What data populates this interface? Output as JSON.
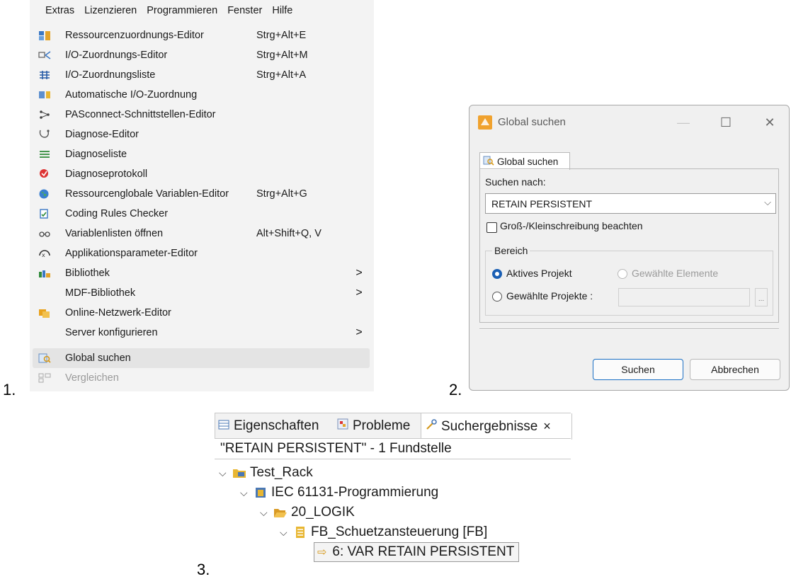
{
  "steps": [
    "1.",
    "2.",
    "3."
  ],
  "menubar": {
    "items": [
      "Extras",
      "Lizenzieren",
      "Programmieren",
      "Fenster",
      "Hilfe"
    ]
  },
  "menu": {
    "items": [
      {
        "label": "Ressourcenzuordnungs-Editor",
        "shortcut": "Strg+Alt+E",
        "icon": "resource-assign-icon"
      },
      {
        "label": "I/O-Zuordnungs-Editor",
        "shortcut": "Strg+Alt+M",
        "icon": "io-assign-icon"
      },
      {
        "label": "I/O-Zuordnungsliste",
        "shortcut": "Strg+Alt+A",
        "icon": "io-list-icon"
      },
      {
        "label": "Automatische I/O-Zuordnung",
        "shortcut": "",
        "icon": "auto-io-icon"
      },
      {
        "label": "PASconnect-Schnittstellen-Editor",
        "shortcut": "",
        "icon": "pasconnect-icon"
      },
      {
        "label": "Diagnose-Editor",
        "shortcut": "",
        "icon": "diagnosis-icon"
      },
      {
        "label": "Diagnoseliste",
        "shortcut": "",
        "icon": "diagnosis-list-icon"
      },
      {
        "label": "Diagnoseprotokoll",
        "shortcut": "",
        "icon": "diagnosis-log-icon"
      },
      {
        "label": "Ressourcenglobale Variablen-Editor",
        "shortcut": "Strg+Alt+G",
        "icon": "globe-icon"
      },
      {
        "label": "Coding Rules Checker",
        "shortcut": "",
        "icon": "rules-checker-icon"
      },
      {
        "label": "Variablenlisten öffnen",
        "shortcut": "Alt+Shift+Q, V",
        "icon": "glasses-icon"
      },
      {
        "label": "Applikationsparameter-Editor",
        "shortcut": "",
        "icon": "parameter-icon"
      },
      {
        "label": "Bibliothek",
        "shortcut": "",
        "icon": "library-icon",
        "submenu": true
      },
      {
        "label": "MDF-Bibliothek",
        "shortcut": "",
        "icon": "",
        "submenu": true
      },
      {
        "label": "Online-Netzwerk-Editor",
        "shortcut": "",
        "icon": "network-icon"
      },
      {
        "label": "Server konfigurieren",
        "shortcut": "",
        "icon": "",
        "submenu": true
      },
      {
        "label": "Global suchen",
        "shortcut": "",
        "icon": "global-search-icon",
        "selected": true
      },
      {
        "label": "Vergleichen",
        "shortcut": "",
        "icon": "compare-icon",
        "disabled": true
      }
    ],
    "submenu_arrow": ">"
  },
  "dialog": {
    "title": "Global suchen",
    "minimize": "—",
    "maximize": "☐",
    "close": "✕",
    "tab_label": "Global suchen",
    "search_for_label": "Suchen nach:",
    "search_value": "RETAIN PERSISTENT",
    "dropdown_arrow": "⌵",
    "case_label": "Groß-/Kleinschreibung beachten",
    "case_checked": false,
    "scope_label": "Bereich",
    "active_project": "Aktives Projekt",
    "selected_elements": "Gewählte Elemente",
    "selected_projects": "Gewählte Projekte :",
    "browse": "...",
    "ok_button": "Suchen",
    "cancel_button": "Abbrechen"
  },
  "results": {
    "tabs": [
      {
        "label": "Eigenschaften",
        "icon": "properties-icon"
      },
      {
        "label": "Probleme",
        "icon": "problems-icon"
      },
      {
        "label": "Suchergebnisse",
        "icon": "search-results-icon",
        "active": true
      }
    ],
    "close": "×",
    "summary": "\"RETAIN PERSISTENT\" - 1 Fundstelle",
    "tree": [
      {
        "label": "Test_Rack",
        "icon": "rack-folder-icon"
      },
      {
        "label": "IEC 61131-Programmierung",
        "icon": "iec-project-icon"
      },
      {
        "label": "20_LOGIK",
        "icon": "folder-open-icon"
      },
      {
        "label": "FB_Schuetzansteuerung [FB]",
        "icon": "function-block-icon"
      },
      {
        "label": "6: VAR RETAIN PERSISTENT",
        "icon": "arrow-right-icon"
      }
    ]
  },
  "colors": {
    "menu_bg": "#f3f3f3",
    "accent": "#1a5fb4",
    "dialog_bg": "#f0f0f0"
  }
}
